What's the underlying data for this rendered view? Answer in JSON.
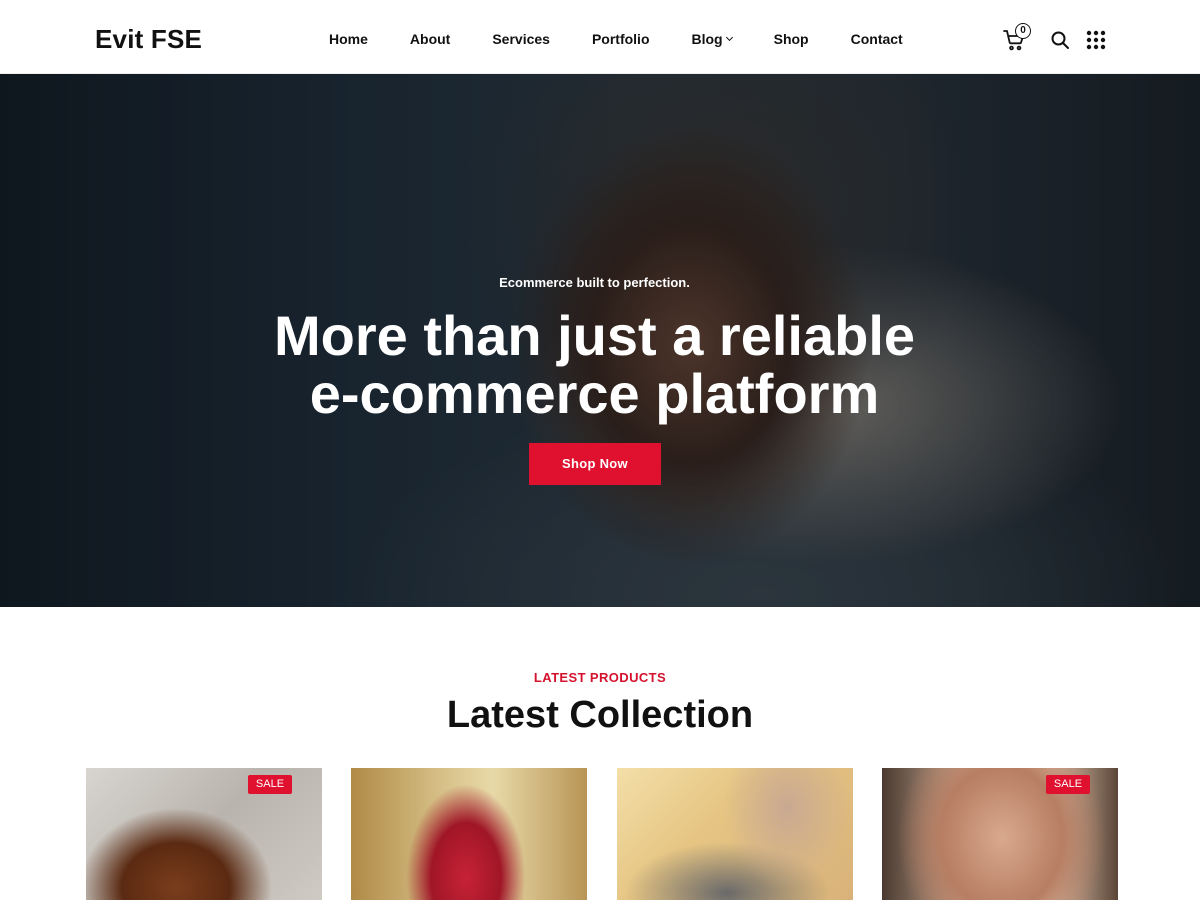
{
  "header": {
    "logo": "Evit FSE",
    "nav": [
      {
        "label": "Home"
      },
      {
        "label": "About"
      },
      {
        "label": "Services"
      },
      {
        "label": "Portfolio"
      },
      {
        "label": "Blog",
        "has_dropdown": true
      },
      {
        "label": "Shop"
      },
      {
        "label": "Contact"
      }
    ],
    "cart_count": "0",
    "icons": [
      "cart-icon",
      "search-icon",
      "grid-menu-icon"
    ]
  },
  "hero": {
    "tagline": "Ecommerce built to perfection.",
    "title_line1": "More than just a reliable",
    "title_line2": "e-commerce platform",
    "button_label": "Shop Now"
  },
  "latest": {
    "label": "LATEST PRODUCTS",
    "title": "Latest Collection",
    "products": [
      {
        "image": "leather-bag",
        "sale": "SALE"
      },
      {
        "image": "woman-red-saree",
        "sale": ""
      },
      {
        "image": "woman-jeans",
        "sale": ""
      },
      {
        "image": "necklace",
        "sale": "SALE"
      }
    ]
  },
  "colors": {
    "accent": "#e0102f",
    "label_red": "#d5122e",
    "text": "#111111"
  }
}
